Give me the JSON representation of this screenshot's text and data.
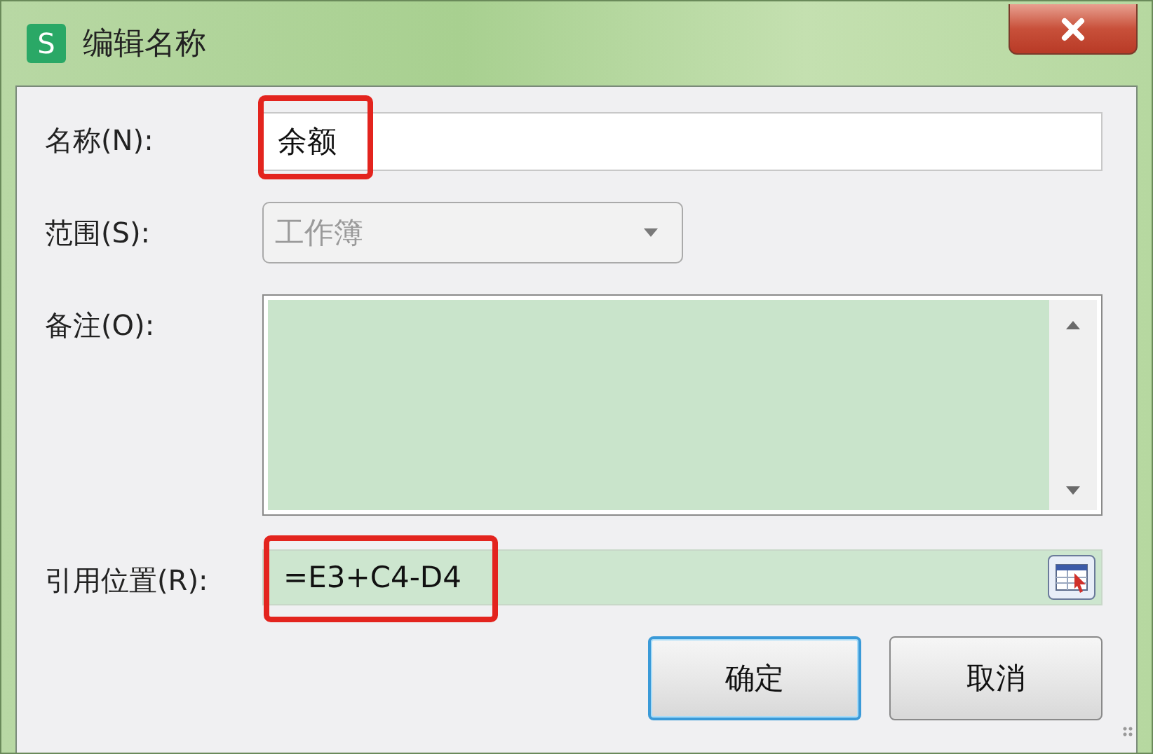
{
  "window": {
    "title": "编辑名称",
    "app_icon_letter": "S"
  },
  "fields": [
    {
      "kind": "text",
      "label": "名称(N):",
      "value": "余额",
      "highlighted": true
    },
    {
      "kind": "dropdown",
      "label": "范围(S):",
      "value": "工作簿",
      "highlighted": false,
      "disabled": true
    },
    {
      "kind": "memo",
      "label": "备注(O):"
    },
    {
      "kind": "reference",
      "label": "引用位置(R):",
      "value": "=E3+C4-D4",
      "highlighted": true
    }
  ],
  "buttons": [
    {
      "label": "确定",
      "default": true
    },
    {
      "label": "取消",
      "default": false
    }
  ]
}
